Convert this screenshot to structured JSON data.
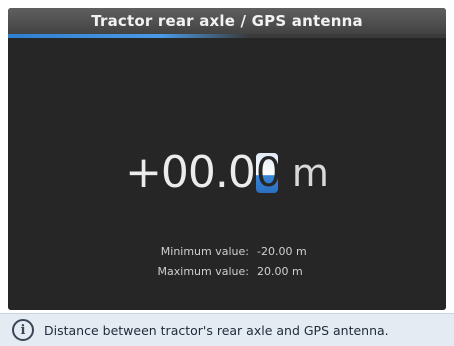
{
  "title": "Tractor rear axle / GPS antenna",
  "value": {
    "prefix": "+00.0",
    "cursor_digit": "0",
    "unit": "m"
  },
  "limits": {
    "min_label": "Minimum value:",
    "min_value": "-20.00 m",
    "max_label": "Maximum value:",
    "max_value": "20.00 m"
  },
  "info": {
    "icon": "info-icon",
    "text": "Distance between tractor's rear axle and GPS antenna."
  },
  "colors": {
    "accent": "#3a86d6",
    "background": "#262626"
  }
}
